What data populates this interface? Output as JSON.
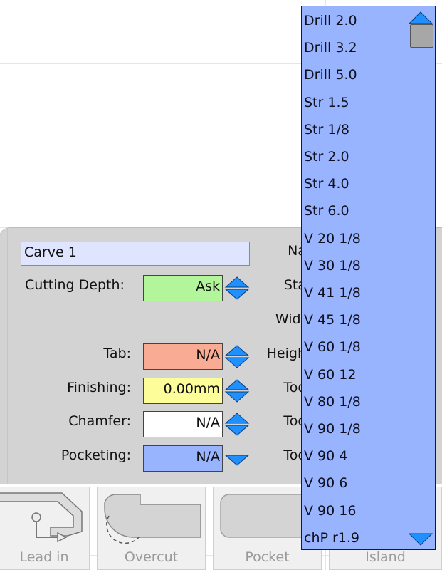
{
  "carve": {
    "name_value": "Carve 1",
    "fields": [
      {
        "label": "Cutting Depth:",
        "value": "Ask",
        "color": "#b3f59b"
      },
      {
        "label": "Tab:",
        "value": "N/A",
        "color": "#f9ab94"
      },
      {
        "label": "Finishing:",
        "value": "0.00mm",
        "color": "#fdfd99"
      },
      {
        "label": "Chamfer:",
        "value": "N/A",
        "color": "#ffffff"
      },
      {
        "label": "Pocketing:",
        "value": "N/A",
        "color": "#99b4ff"
      }
    ],
    "side_labels": [
      "Na",
      "Sta",
      "Widt",
      "Heigh",
      "Too",
      "Too",
      "Too"
    ]
  },
  "tool_buttons": [
    {
      "label": "Lead in",
      "icon": "lead-in-icon"
    },
    {
      "label": "Overcut",
      "icon": "overcut-icon"
    },
    {
      "label": "Pocket",
      "icon": "pocket-icon"
    },
    {
      "label": "Island",
      "icon": "island-icon"
    }
  ],
  "bit_dropdown": {
    "items": [
      "Drill 2.0",
      "Drill 3.2",
      "Drill 5.0",
      "Str 1.5",
      "Str 1/8",
      "Str 2.0",
      "Str 4.0",
      "Str 6.0",
      "V 20 1/8",
      "V 30 1/8",
      "V 41 1/8",
      "V 45 1/8",
      "V 60 1/8",
      "V 60 12",
      "V 80 1/8",
      "V 90 1/8",
      "V 90 4",
      "V 90 6",
      "V 90 16",
      "chP r1.9"
    ],
    "colors": {
      "background": "#99b4ff",
      "arrow": "#1e90ff"
    }
  }
}
